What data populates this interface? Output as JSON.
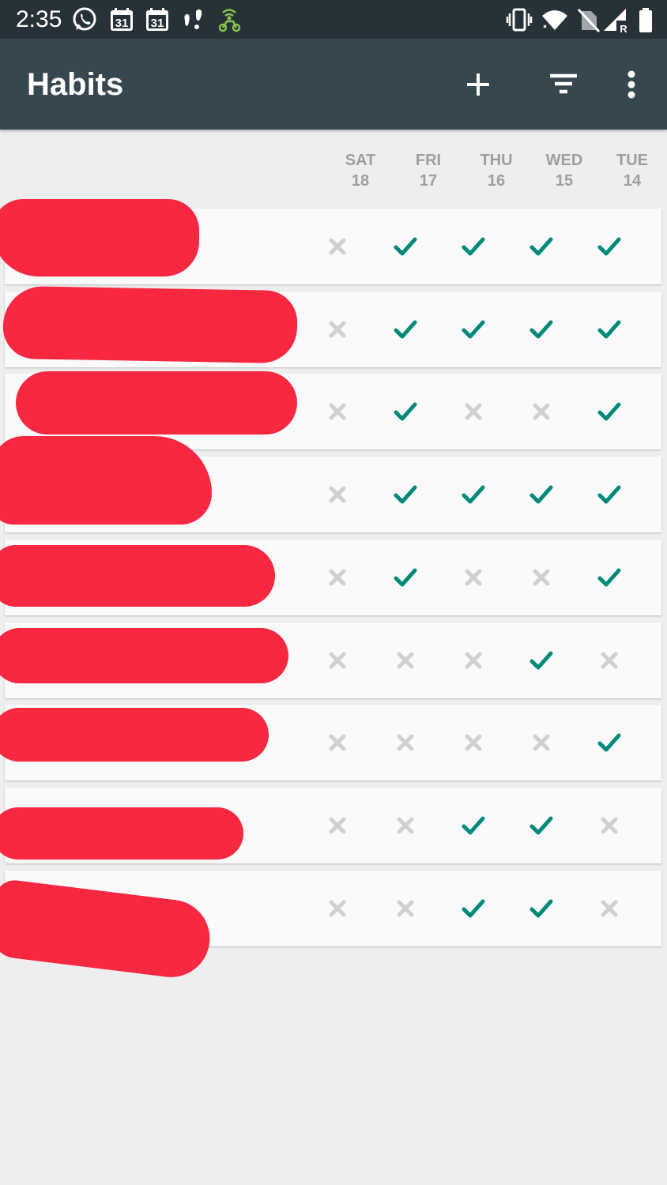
{
  "status_bar": {
    "time": "2:35",
    "icons": [
      "whatsapp-icon",
      "calendar-31-icon",
      "calendar-31-icon",
      "notification-icon",
      "delivery-app-icon",
      "vibrate-icon",
      "wifi-icon",
      "no-sim-icon",
      "signal-roaming-icon",
      "battery-icon"
    ],
    "calendar_day": "31",
    "roaming_label": "R"
  },
  "app_bar": {
    "title": "Habits",
    "actions": [
      "add-icon",
      "filter-icon",
      "more-vert-icon"
    ]
  },
  "days": [
    {
      "name": "SAT",
      "date": "18"
    },
    {
      "name": "FRI",
      "date": "17"
    },
    {
      "name": "THU",
      "date": "16"
    },
    {
      "name": "WED",
      "date": "15"
    },
    {
      "name": "TUE",
      "date": "14"
    }
  ],
  "habits": [
    {
      "name": "",
      "checks": [
        false,
        true,
        true,
        true,
        true
      ]
    },
    {
      "name": "",
      "checks": [
        false,
        true,
        true,
        true,
        true
      ]
    },
    {
      "name": "",
      "checks": [
        false,
        true,
        false,
        false,
        true
      ]
    },
    {
      "name": "",
      "checks": [
        false,
        true,
        true,
        true,
        true
      ]
    },
    {
      "name": "",
      "checks": [
        false,
        true,
        false,
        false,
        true
      ]
    },
    {
      "name": "",
      "checks": [
        false,
        false,
        false,
        true,
        false
      ]
    },
    {
      "name": "",
      "checks": [
        false,
        false,
        false,
        false,
        true
      ]
    },
    {
      "name": "",
      "checks": [
        false,
        false,
        true,
        true,
        false
      ]
    },
    {
      "name": "",
      "checks": [
        false,
        false,
        true,
        true,
        false
      ]
    }
  ],
  "colors": {
    "status_bar": "#263238",
    "app_bar": "#37474f",
    "check": "#00897b",
    "cross": "#d0d0d0",
    "redaction": "#f72840"
  }
}
